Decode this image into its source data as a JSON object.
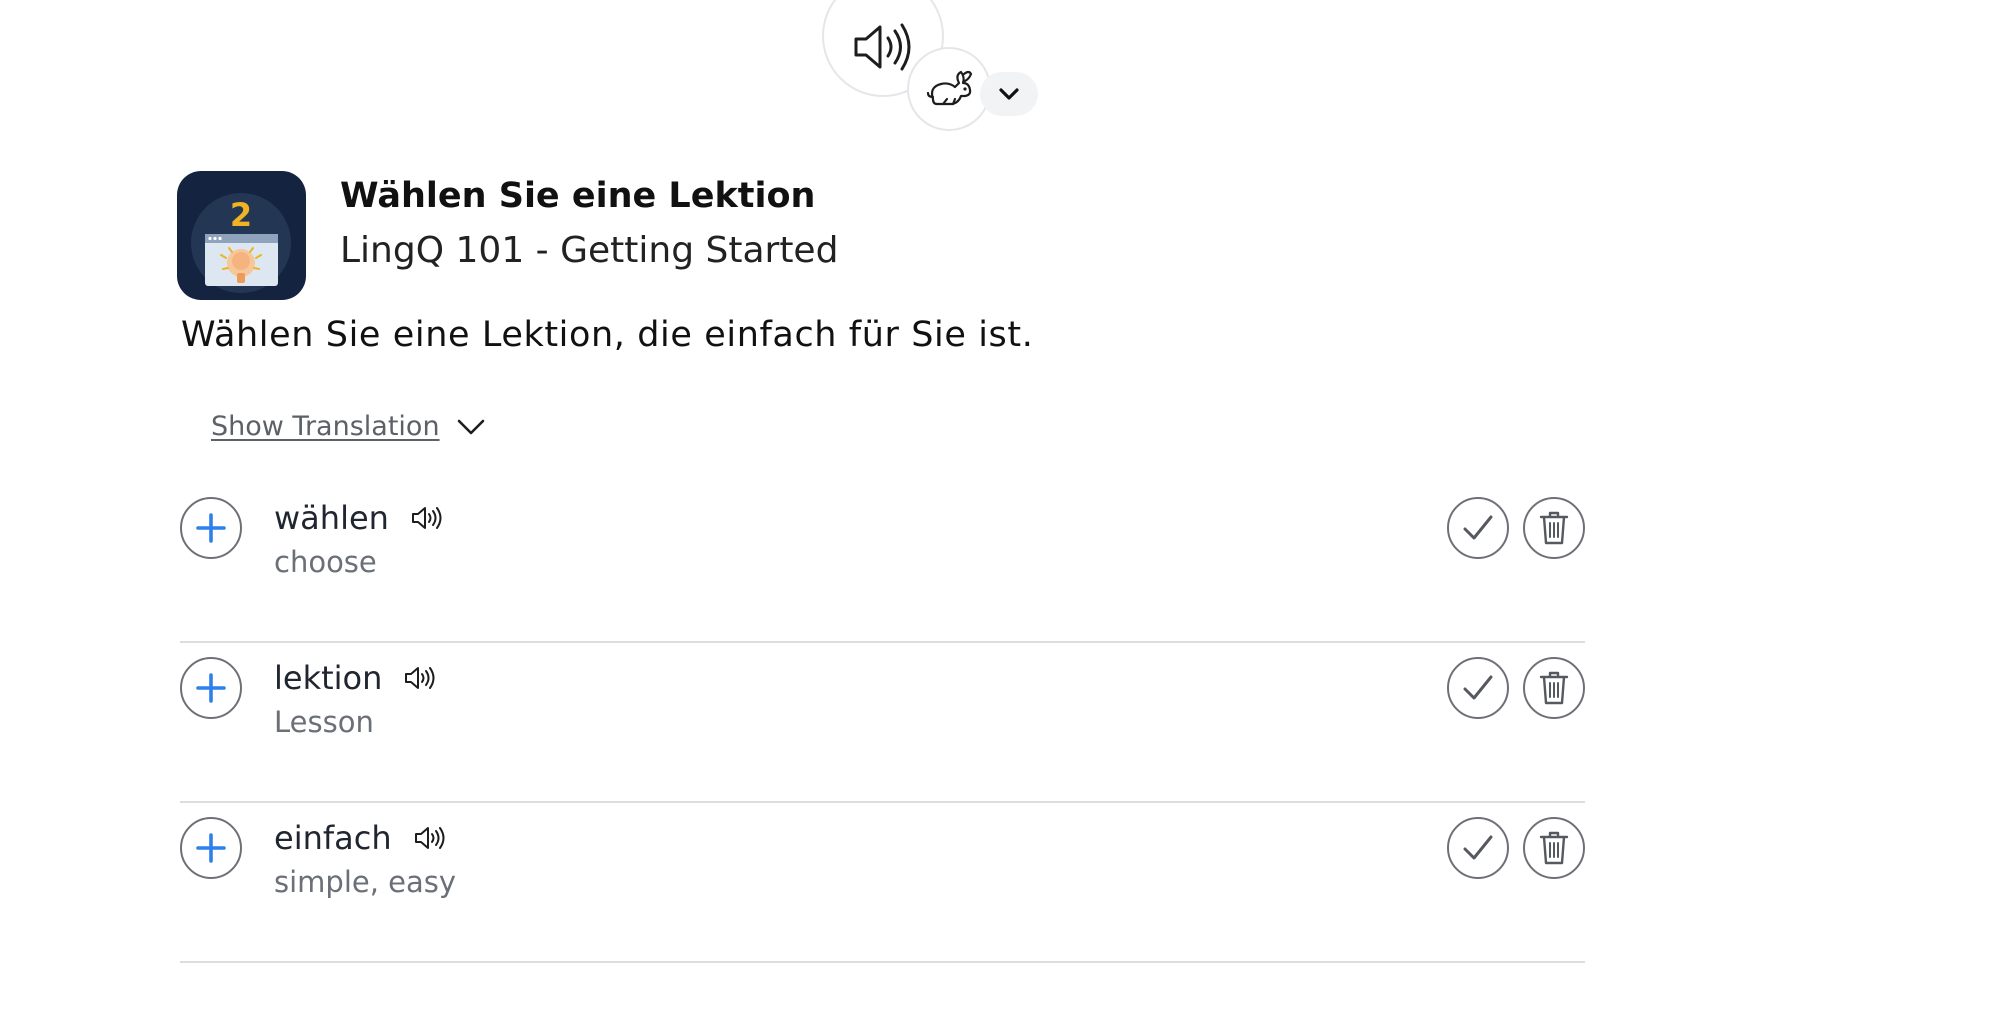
{
  "player": {
    "play_icon": "speaker-icon",
    "speed_icon": "rabbit-icon",
    "dropdown_icon": "chevron-down-icon"
  },
  "lesson": {
    "course_image_number": "2",
    "title": "Wählen Sie eine Lektion",
    "course": "LingQ 101 - Getting Started",
    "sentence": "Wählen Sie eine Lektion, die einfach für Sie ist."
  },
  "translation_toggle": {
    "label": "Show Translation"
  },
  "words": [
    {
      "term": "wählen",
      "hint": "choose"
    },
    {
      "term": "lektion",
      "hint": "Lesson"
    },
    {
      "term": "einfach",
      "hint": "simple, easy"
    }
  ],
  "colors": {
    "accent_blue": "#2f80ed",
    "course_image_bg": "#14233f",
    "course_number": "#f0b323",
    "divider": "#dcdde0"
  }
}
